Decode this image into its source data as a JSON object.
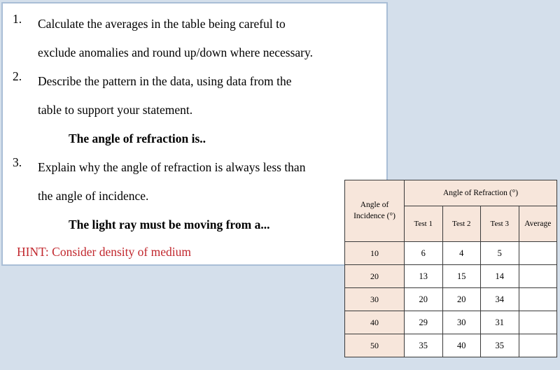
{
  "slide": {
    "background_color": "#d4dfeb",
    "textbox": {
      "border_color": "#a9bed6",
      "background_color": "#ffffff",
      "questions": [
        {
          "number": "1.",
          "lines": [
            "Calculate the averages in the table being careful to",
            "exclude anomalies and round up/down where necessary."
          ]
        },
        {
          "number": "2.",
          "lines": [
            "Describe the pattern in the data, using data from the",
            "table to support your statement."
          ]
        },
        {
          "number": "3.",
          "lines": [
            "Explain why the angle of refraction is always less than",
            "the angle of incidence."
          ]
        }
      ],
      "answer_stem_1": "The angle of refraction is..",
      "answer_stem_2": "The light ray must be moving from a...",
      "hint": "HINT: Consider density of medium",
      "hint_color": "#c1272d"
    }
  },
  "chart_data": {
    "type": "table",
    "title": "Angle of Refraction (°)",
    "header": {
      "incidence_label": "Angle of\nIncidence (°)",
      "incidence_label_line1": "Angle of",
      "incidence_label_line2": "Incidence (°)",
      "refraction_group_label": "Angle of Refraction (°)",
      "sub_columns": [
        "Test 1",
        "Test 2",
        "Test 3",
        "Average"
      ]
    },
    "categories": [
      10,
      20,
      30,
      40,
      50
    ],
    "xlabel": "Angle of Incidence (°)",
    "ylabel": "Angle of Refraction (°)",
    "series": [
      {
        "name": "Test 1",
        "values": [
          6,
          13,
          20,
          29,
          35
        ]
      },
      {
        "name": "Test 2",
        "values": [
          4,
          15,
          20,
          30,
          40
        ]
      },
      {
        "name": "Test 3",
        "values": [
          5,
          14,
          34,
          31,
          35
        ]
      },
      {
        "name": "Average",
        "values": [
          "",
          "",
          "",
          "",
          ""
        ]
      }
    ],
    "rows": [
      {
        "incidence": "10",
        "test1": "6",
        "test2": "4",
        "test3": "5",
        "average": ""
      },
      {
        "incidence": "20",
        "test1": "13",
        "test2": "15",
        "test3": "14",
        "average": ""
      },
      {
        "incidence": "30",
        "test1": "20",
        "test2": "20",
        "test3": "34",
        "average": ""
      },
      {
        "incidence": "40",
        "test1": "29",
        "test2": "30",
        "test3": "31",
        "average": ""
      },
      {
        "incidence": "50",
        "test1": "35",
        "test2": "40",
        "test3": "35",
        "average": ""
      }
    ],
    "header_fill_color": "#f7e6db",
    "cell_fill_color": "#ffffff",
    "border_color": "#3a3a3a",
    "grid": true
  }
}
